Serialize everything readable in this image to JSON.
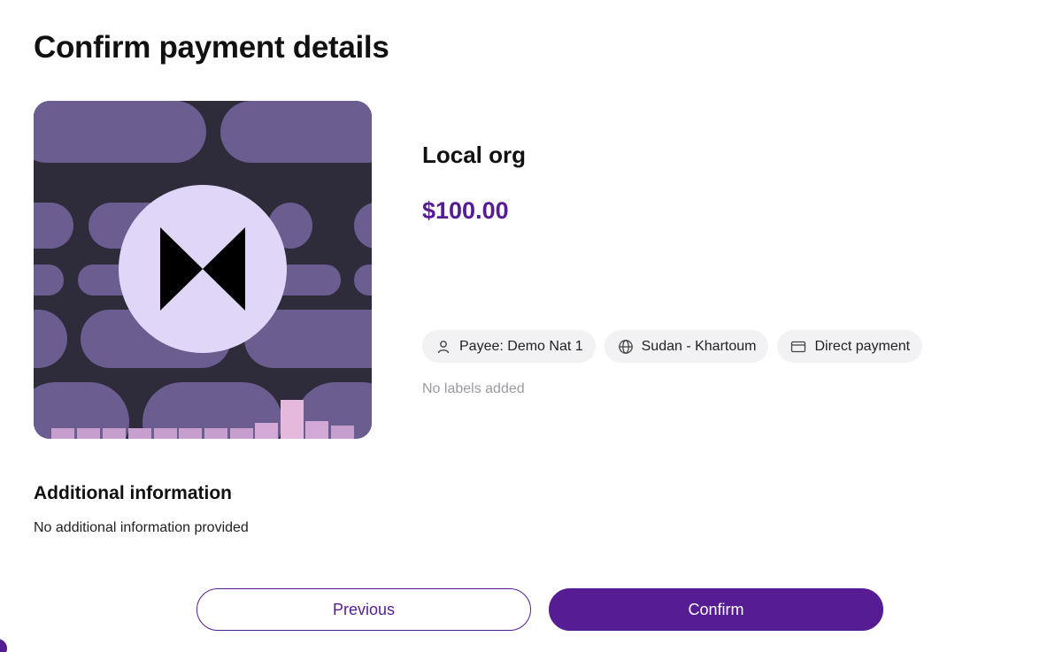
{
  "page": {
    "title": "Confirm payment details"
  },
  "recipient": {
    "name": "Local org",
    "amount": "$100.00",
    "artwork_icon": "bowtie-logo-icon"
  },
  "chips": {
    "payee": {
      "label": "Payee: Demo Nat 1",
      "icon": "person-icon"
    },
    "location": {
      "label": "Sudan - Khartoum",
      "icon": "globe-icon"
    },
    "method": {
      "label": "Direct payment",
      "icon": "credit-card-icon"
    }
  },
  "labels": {
    "empty_text": "No labels added"
  },
  "additional_info": {
    "heading": "Additional information",
    "body": "No additional information provided"
  },
  "actions": {
    "previous_label": "Previous",
    "confirm_label": "Confirm"
  },
  "colors": {
    "accent": "#561c94",
    "artwork_background": "#2e2b3b",
    "artwork_pill": "#6b5d8f",
    "artwork_circle": "#e0d6f8",
    "chip_background": "#f2f2f4"
  }
}
